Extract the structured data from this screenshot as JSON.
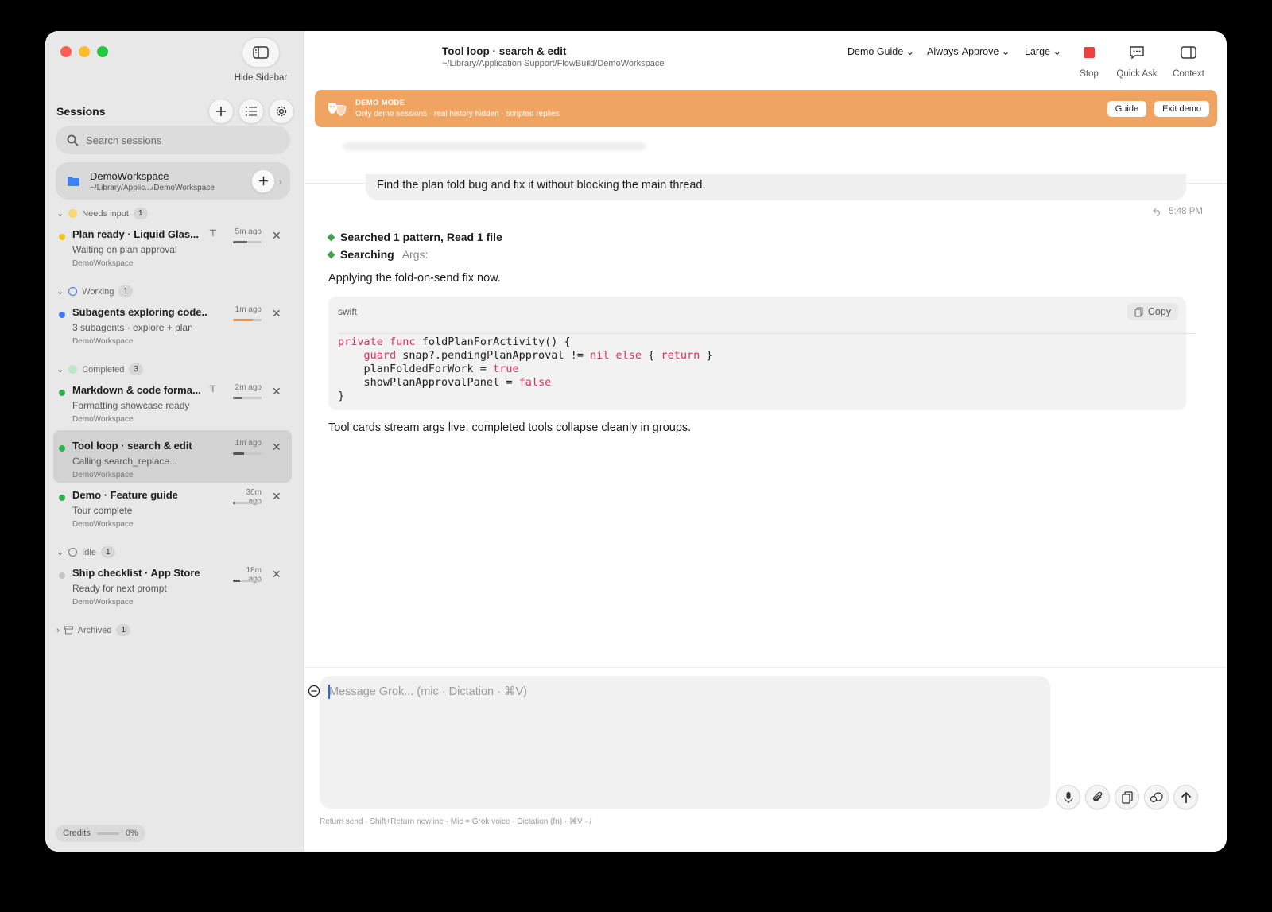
{
  "sidebar": {
    "hide_label": "Hide Sidebar",
    "sessions_title": "Sessions",
    "search_placeholder": "Search sessions",
    "workspace": {
      "name": "DemoWorkspace",
      "path": "~/Library/Applic.../DemoWorkspace"
    },
    "groups": {
      "needs_input": {
        "label": "Needs input",
        "count": "1"
      },
      "working": {
        "label": "Working",
        "count": "1"
      },
      "completed": {
        "label": "Completed",
        "count": "3"
      },
      "idle": {
        "label": "Idle",
        "count": "1"
      },
      "archived": {
        "label": "Archived",
        "count": "1"
      }
    },
    "sessions": [
      {
        "title": "Plan ready · Liquid Glas...",
        "subtitle": "Waiting on plan approval",
        "workspace": "DemoWorkspace",
        "ago": "5m ago",
        "progress": 0.5,
        "dot_color": "#f1c21b",
        "bar_color": "#666666"
      },
      {
        "title": "Subagents exploring code...",
        "subtitle": "3 subagents · explore + plan",
        "workspace": "DemoWorkspace",
        "ago": "1m ago",
        "progress": 0.7,
        "dot_color": "#3b7af2",
        "bar_color": "#f08c3c"
      },
      {
        "title": "Markdown & code forma...",
        "subtitle": "Formatting showcase ready",
        "workspace": "DemoWorkspace",
        "ago": "2m ago",
        "progress": 0.3,
        "dot_color": "#2db24b",
        "bar_color": "#666666"
      },
      {
        "title": "Tool loop · search & edit",
        "subtitle": "Calling search_replace...",
        "workspace": "DemoWorkspace",
        "ago": "1m ago",
        "progress": 0.4,
        "dot_color": "#2db24b",
        "bar_color": "#555555"
      },
      {
        "title": "Demo · Feature guide",
        "subtitle": "Tour complete",
        "workspace": "DemoWorkspace",
        "ago": "30m ago",
        "progress": 0.06,
        "dot_color": "#2db24b",
        "bar_color": "#555555"
      },
      {
        "title": "Ship checklist · App Store",
        "subtitle": "Ready for next prompt",
        "workspace": "DemoWorkspace",
        "ago": "18m ago",
        "progress": 0.25,
        "dot_color": "#c4c4c4",
        "bar_color": "#555555"
      }
    ],
    "credits_label": "Credits",
    "credits_value": "0%"
  },
  "topbar": {
    "title": "Tool loop · search & edit",
    "path": "~/Library/Application Support/FlowBuild/DemoWorkspace",
    "guide_dropdown": "Demo Guide",
    "approve_dropdown": "Always-Approve",
    "size_dropdown": "Large",
    "stop_label": "Stop",
    "quick_ask_label": "Quick Ask",
    "context_label": "Context"
  },
  "banner": {
    "title": "DEMO MODE",
    "subtitle": "Only demo sessions · real history hidden · scripted replies",
    "guide_button": "Guide",
    "exit_button": "Exit demo"
  },
  "chat": {
    "user_message": "Find the plan fold bug and fix it without blocking the main thread.",
    "time": "5:48 PM",
    "step1": "Searched 1 pattern, Read 1 file",
    "step2": "Searching",
    "step2_args": "Args:",
    "intro": "Applying the fold-on-send fix now.",
    "code_lang": "swift",
    "copy_label": "Copy",
    "outro": "Tool cards stream args live; completed tools collapse cleanly in groups."
  },
  "composer": {
    "placeholder": "Message Grok...  (mic · Dictation · ⌘V)",
    "hint": "Return send  ·  Shift+Return newline  ·  Mic = Grok voice  ·  Dictation (fn)  ·  ⌘V  ·  /"
  }
}
